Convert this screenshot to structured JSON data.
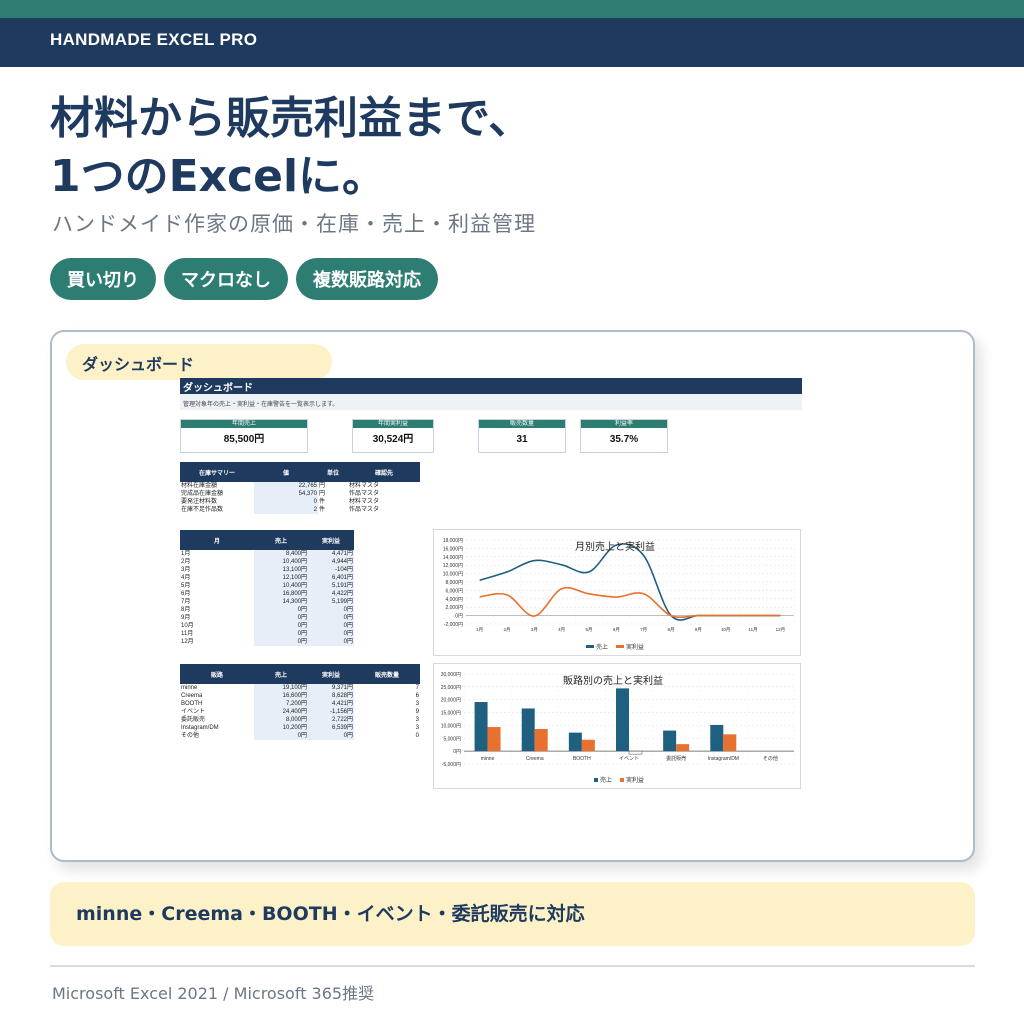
{
  "brand": "HANDMADE EXCEL PRO",
  "headline": {
    "line1": "材料から販売利益まで、",
    "line2": "1つのExcelに。"
  },
  "subtitle": "ハンドメイド作家の原価・在庫・売上・利益管理",
  "tags": [
    "買い切り",
    "マクロなし",
    "複数販路対応"
  ],
  "card": {
    "label": "ダッシュボード",
    "sheet": {
      "title": "ダッシュボード",
      "note": "管理対象年の売上・実利益・在庫警告を一覧表示します。",
      "kpis": [
        {
          "label": "年間売上",
          "value": "85,500円"
        },
        {
          "label": "年間実利益",
          "value": "30,524円"
        },
        {
          "label": "販売数量",
          "value": "31"
        },
        {
          "label": "利益率",
          "value": "35.7%"
        }
      ],
      "inventory": {
        "headers": [
          "在庫サマリー",
          "値",
          "単位",
          "確認先"
        ],
        "rows": [
          [
            "材料在庫金額",
            "22,765",
            "円",
            "材料マスタ"
          ],
          [
            "完成品在庫金額",
            "54,370",
            "円",
            "作品マスタ"
          ],
          [
            "要発注材料数",
            "0",
            "件",
            "材料マスタ"
          ],
          [
            "在庫不足作品数",
            "2",
            "件",
            "作品マスタ"
          ]
        ]
      },
      "monthly": {
        "headers": [
          "月",
          "売上",
          "実利益"
        ],
        "rows": [
          [
            "1月",
            "8,400円",
            "4,471円"
          ],
          [
            "2月",
            "10,400円",
            "4,944円"
          ],
          [
            "3月",
            "13,100円",
            "-104円"
          ],
          [
            "4月",
            "12,100円",
            "6,401円"
          ],
          [
            "5月",
            "10,400円",
            "5,191円"
          ],
          [
            "6月",
            "16,800円",
            "4,422円"
          ],
          [
            "7月",
            "14,300円",
            "5,199円"
          ],
          [
            "8月",
            "0円",
            "0円"
          ],
          [
            "9月",
            "0円",
            "0円"
          ],
          [
            "10月",
            "0円",
            "0円"
          ],
          [
            "11月",
            "0円",
            "0円"
          ],
          [
            "12月",
            "0円",
            "0円"
          ]
        ]
      },
      "channels": {
        "headers": [
          "販路",
          "売上",
          "実利益",
          "販売数量"
        ],
        "rows": [
          [
            "minne",
            "19,100円",
            "9,371円",
            "7"
          ],
          [
            "Creema",
            "16,600円",
            "8,628円",
            "6"
          ],
          [
            "BOOTH",
            "7,200円",
            "4,421円",
            "3"
          ],
          [
            "イベント",
            "24,400円",
            "-1,156円",
            "9"
          ],
          [
            "委託販売",
            "8,000円",
            "2,722円",
            "3"
          ],
          [
            "Instagram/DM",
            "10,200円",
            "6,539円",
            "3"
          ],
          [
            "その他",
            "0円",
            "0円",
            "0"
          ]
        ]
      }
    }
  },
  "chart_data": [
    {
      "type": "line",
      "title": "月別売上と実利益",
      "categories": [
        "1月",
        "2月",
        "3月",
        "4月",
        "5月",
        "6月",
        "7月",
        "8月",
        "9月",
        "10月",
        "11月",
        "12月"
      ],
      "y_ticks": [
        "-2,000円",
        "0円",
        "2,000円",
        "4,000円",
        "6,000円",
        "8,000円",
        "10,000円",
        "12,000円",
        "14,000円",
        "16,000円",
        "18,000円"
      ],
      "ylim": [
        -2000,
        18000
      ],
      "series": [
        {
          "name": "売上",
          "color": "#1f5f7f",
          "values": [
            8400,
            10400,
            13100,
            12100,
            10400,
            16800,
            14300,
            0,
            0,
            0,
            0,
            0
          ]
        },
        {
          "name": "実利益",
          "color": "#e8712f",
          "values": [
            4471,
            4944,
            -104,
            6401,
            5191,
            4422,
            5199,
            0,
            0,
            0,
            0,
            0
          ]
        }
      ],
      "legend": "bottom",
      "grid": true
    },
    {
      "type": "bar",
      "title": "販路別の売上と実利益",
      "categories": [
        "minne",
        "Creema",
        "BOOTH",
        "イベント",
        "委託販売",
        "Instagram/DM",
        "その他"
      ],
      "y_ticks": [
        "-5,000円",
        "0円",
        "5,000円",
        "10,000円",
        "15,000円",
        "20,000円",
        "25,000円",
        "30,000円"
      ],
      "ylim": [
        -5000,
        30000
      ],
      "series": [
        {
          "name": "売上",
          "color": "#1f5f7f",
          "values": [
            19100,
            16600,
            7200,
            24400,
            8000,
            10200,
            0
          ]
        },
        {
          "name": "実利益",
          "color": "#e8712f",
          "values": [
            9371,
            8628,
            4421,
            -1156,
            2722,
            6539,
            0
          ]
        }
      ],
      "legend": "bottom",
      "grid": true
    }
  ],
  "footer": "minne・Creema・BOOTH・イベント・委託販売に対応",
  "requirements": "Microsoft Excel 2021 / Microsoft 365推奨"
}
